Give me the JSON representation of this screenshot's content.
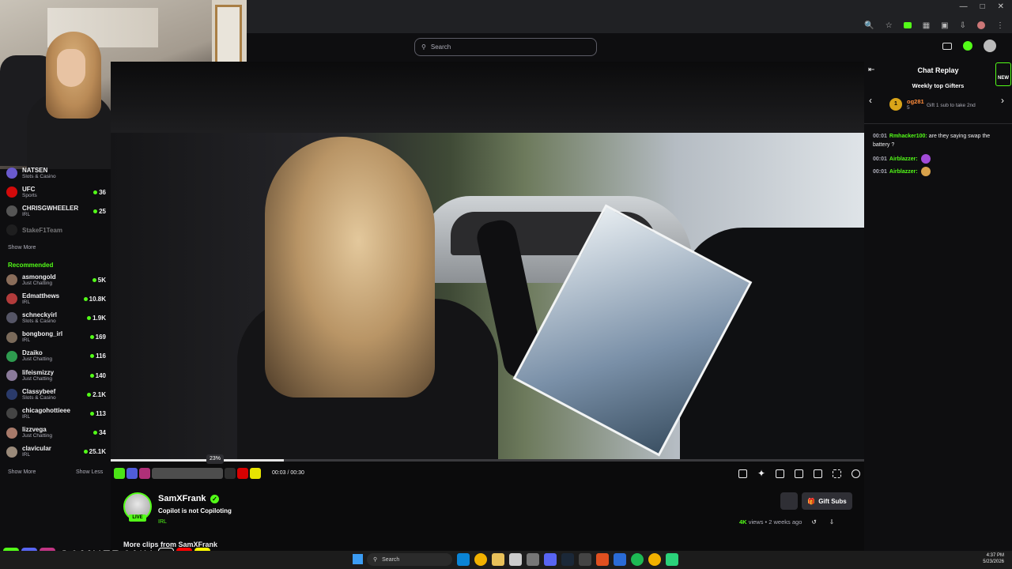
{
  "browser": {
    "icons": [
      "zoom-icon",
      "star-icon",
      "extension-icon",
      "profile-icon"
    ]
  },
  "nav": {
    "search_placeholder": "Search"
  },
  "sidebar": {
    "followed": [
      {
        "name": "NATSEN",
        "category": "Slots & Casino",
        "count": "",
        "color": "#6a5acd"
      },
      {
        "name": "UFC",
        "category": "Sports",
        "count": "36",
        "color": "#d20a0a"
      },
      {
        "name": "CHRISGWHEELER",
        "category": "IRL",
        "count": "25",
        "color": "#555"
      },
      {
        "name": "StakeF1Team",
        "category": "",
        "count": "",
        "color": "#333"
      }
    ],
    "show_more_top": "Show More",
    "recommended_heading": "Recommended",
    "recommended": [
      {
        "name": "asmongold",
        "category": "Just Chatting",
        "count": "5K",
        "color": "#8a6d5a"
      },
      {
        "name": "Edmatthews",
        "category": "IRL",
        "count": "10.8K",
        "color": "#b23b3b"
      },
      {
        "name": "schneckyirl",
        "category": "Slots & Casino",
        "count": "1.9K",
        "color": "#556"
      },
      {
        "name": "bongbong_irl",
        "category": "IRL",
        "count": "169",
        "color": "#7a6a5a"
      },
      {
        "name": "Dzaiko",
        "category": "Just Chatting",
        "count": "116",
        "color": "#2e9b4f"
      },
      {
        "name": "lifeismizzy",
        "category": "Just Chatting",
        "count": "140",
        "color": "#8a7a9a"
      },
      {
        "name": "Classybeef",
        "category": "Slots & Casino",
        "count": "2.1K",
        "color": "#2a3a6a"
      },
      {
        "name": "chicagohottieee",
        "category": "IRL",
        "count": "113",
        "color": "#444"
      },
      {
        "name": "lizzvega",
        "category": "Just Chatting",
        "count": "34",
        "color": "#a87a6a"
      },
      {
        "name": "clavicular",
        "category": "IRL",
        "count": "25.1K",
        "color": "#9a8a7a"
      }
    ],
    "show_more_bottom": "Show More",
    "show_less": "Show Less"
  },
  "player": {
    "progress_percent": 23,
    "tooltip": "23%",
    "time_current": "00:03",
    "time_total": "00:30",
    "controls": [
      "crop-icon",
      "sparkle-icon",
      "theater-icon",
      "pip-icon",
      "miniplayer-icon",
      "fullscreen-icon",
      "settings-icon"
    ]
  },
  "channel": {
    "name": "SamXFrank",
    "live": "LIVE",
    "title": "Copilot is not Copiloting",
    "category": "IRL",
    "views_count": "4K",
    "views_label": "views",
    "age": "• 2 weeks ago",
    "gift_subs": "Gift Subs",
    "more_clips": "More clips from SamXFrank"
  },
  "chat": {
    "title": "Chat Replay",
    "new_label": "NEW",
    "weekly_title": "Weekly top Gifters",
    "top_gifter": {
      "rank": "1",
      "name": "og281",
      "count": "5"
    },
    "gift_note": "Gift 1 sub to take 2nd",
    "messages": [
      {
        "time": "00:01",
        "user": "Rmhacker100:",
        "text": "are they saying swap the battery ?"
      },
      {
        "time": "00:01",
        "user": "Airblazzer:",
        "text": ""
      },
      {
        "time": "00:01",
        "user": "Airblazzer:",
        "text": ""
      }
    ]
  },
  "overlay": {
    "brand": "SAMXFRANK"
  },
  "taskbar": {
    "search": "Search",
    "time": "4:37 PM",
    "date": "5/23/2026"
  }
}
